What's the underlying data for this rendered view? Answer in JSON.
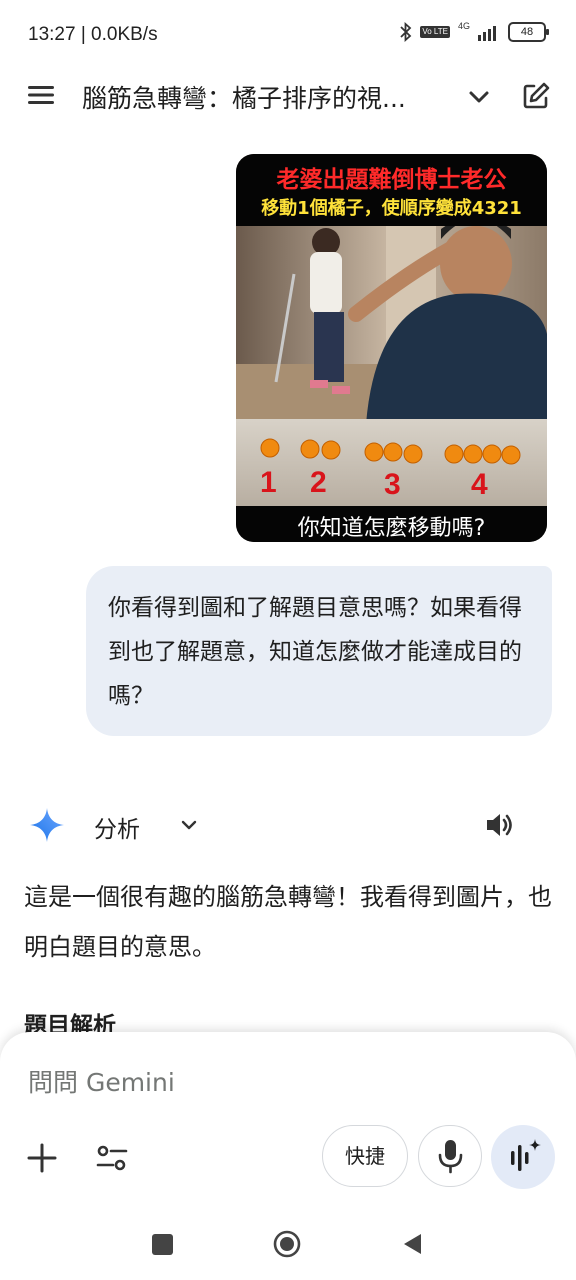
{
  "status_bar": {
    "time": "13:27 | 0.0KB/s",
    "network": "4G",
    "volte": "Vo LTE",
    "battery": "48"
  },
  "header": {
    "title": "腦筋急轉彎：橘子排序的視..."
  },
  "uploaded_image": {
    "line1": "老婆出題難倒博士老公",
    "line2": "移動1個橘子，使順序變成4321",
    "bottom": "你知道怎麼移動嗎?",
    "numbers": [
      "1",
      "2",
      "3",
      "4"
    ]
  },
  "user_message": {
    "text": "你看得到圖和了解題目意思嗎？如果看得到也了解題意，知道怎麼做才能達成目的嗎？"
  },
  "response": {
    "mode_label": "分析",
    "paragraph": "這是一個很有趣的腦筋急轉彎！我看得到圖片，也明白題目的意思。",
    "section_heading": "題目解析"
  },
  "input": {
    "placeholder": "問問 Gemini",
    "shortcut_label": "快捷"
  },
  "colors": {
    "bubble": "#e9eef6",
    "live_button": "#e3eaf7",
    "gemini_blue": "#4285f4"
  }
}
